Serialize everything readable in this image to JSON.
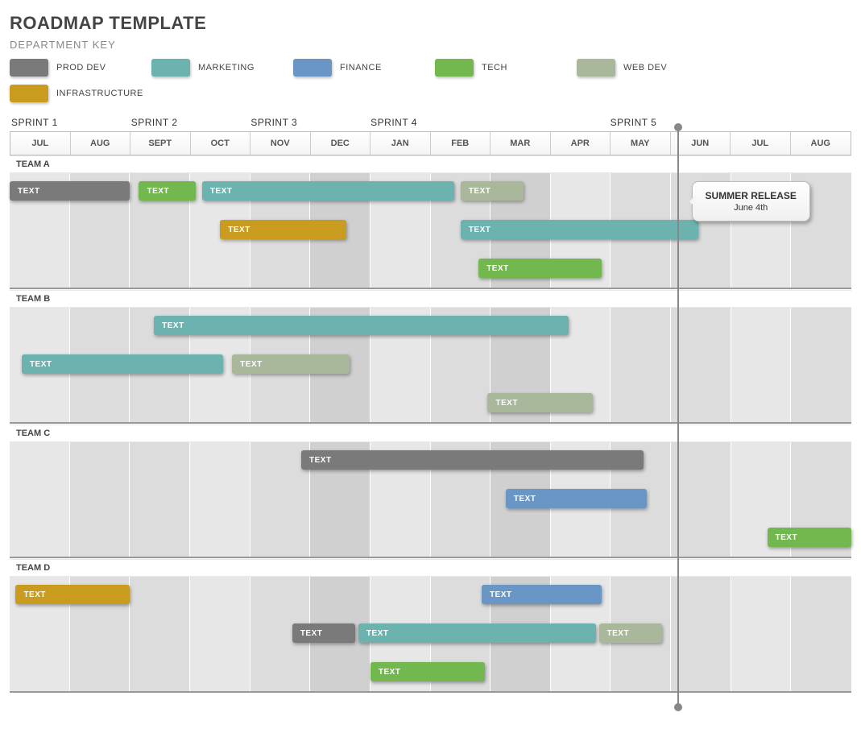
{
  "title": "ROADMAP TEMPLATE",
  "subtitle": "DEPARTMENT KEY",
  "departments": [
    {
      "name": "PROD DEV",
      "color": "#7a7a7a"
    },
    {
      "name": "MARKETING",
      "color": "#6cb3b0"
    },
    {
      "name": "FINANCE",
      "color": "#6a96c5"
    },
    {
      "name": "TECH",
      "color": "#73b74f"
    },
    {
      "name": "WEB DEV",
      "color": "#a9b79a"
    },
    {
      "name": "INFRASTRUCTURE",
      "color": "#c99c1f"
    }
  ],
  "sprints": [
    "SPRINT 1",
    "SPRINT 2",
    "SPRINT 3",
    "SPRINT 4",
    "SPRINT 5"
  ],
  "sprint_start_month_index": [
    0,
    2,
    3.6,
    6,
    10
  ],
  "months": [
    "JUL",
    "AUG",
    "SEPT",
    "OCT",
    "NOV",
    "DEC",
    "JAN",
    "FEB",
    "MAR",
    "APR",
    "MAY",
    "JUN",
    "JUL",
    "AUG"
  ],
  "month_shade": [
    "l",
    "m",
    "m",
    "l",
    "m",
    "d",
    "l",
    "m",
    "d",
    "l",
    "m",
    "m",
    "l",
    "m"
  ],
  "milestone": {
    "month_index": 11.1,
    "title": "SUMMER RELEASE",
    "subtitle": "June 4th"
  },
  "bar_label": "TEXT",
  "chart_data": {
    "type": "bar",
    "title": "ROADMAP TEMPLATE",
    "xlabel": "",
    "ylabel": "",
    "x_categories": [
      "JUL",
      "AUG",
      "SEPT",
      "OCT",
      "NOV",
      "DEC",
      "JAN",
      "FEB",
      "MAR",
      "APR",
      "MAY",
      "JUN",
      "JUL",
      "AUG"
    ],
    "teams": [
      {
        "name": "TEAM A",
        "lanes": 3,
        "bars": [
          {
            "lane": 0,
            "department": "PROD DEV",
            "start": 0.0,
            "end": 2.0,
            "label": "TEXT"
          },
          {
            "lane": 0,
            "department": "TECH",
            "start": 2.15,
            "end": 3.1,
            "label": "TEXT"
          },
          {
            "lane": 0,
            "department": "MARKETING",
            "start": 3.2,
            "end": 7.4,
            "label": "TEXT"
          },
          {
            "lane": 0,
            "department": "WEB DEV",
            "start": 7.5,
            "end": 8.55,
            "label": "TEXT"
          },
          {
            "lane": 1,
            "department": "INFRASTRUCTURE",
            "start": 3.5,
            "end": 5.6,
            "label": "TEXT"
          },
          {
            "lane": 1,
            "department": "MARKETING",
            "start": 7.5,
            "end": 11.45,
            "label": "TEXT"
          },
          {
            "lane": 2,
            "department": "TECH",
            "start": 7.8,
            "end": 9.85,
            "label": "TEXT"
          }
        ]
      },
      {
        "name": "TEAM B",
        "lanes": 3,
        "bars": [
          {
            "lane": 0,
            "department": "MARKETING",
            "start": 2.4,
            "end": 9.3,
            "label": "TEXT"
          },
          {
            "lane": 1,
            "department": "MARKETING",
            "start": 0.2,
            "end": 3.55,
            "label": "TEXT"
          },
          {
            "lane": 1,
            "department": "WEB DEV",
            "start": 3.7,
            "end": 5.65,
            "label": "TEXT"
          },
          {
            "lane": 2,
            "department": "WEB DEV",
            "start": 7.95,
            "end": 9.7,
            "label": "TEXT"
          }
        ]
      },
      {
        "name": "TEAM C",
        "lanes": 3,
        "bars": [
          {
            "lane": 0,
            "department": "PROD DEV",
            "start": 4.85,
            "end": 10.55,
            "label": "TEXT"
          },
          {
            "lane": 1,
            "department": "FINANCE",
            "start": 8.25,
            "end": 10.6,
            "label": "TEXT"
          },
          {
            "lane": 2,
            "department": "TECH",
            "start": 12.6,
            "end": 14.0,
            "label": "TEXT"
          }
        ]
      },
      {
        "name": "TEAM D",
        "lanes": 3,
        "bars": [
          {
            "lane": 0,
            "department": "INFRASTRUCTURE",
            "start": 0.1,
            "end": 2.0,
            "label": "TEXT"
          },
          {
            "lane": 0,
            "department": "FINANCE",
            "start": 7.85,
            "end": 9.85,
            "label": "TEXT"
          },
          {
            "lane": 1,
            "department": "PROD DEV",
            "start": 4.7,
            "end": 5.75,
            "label": "TEXT"
          },
          {
            "lane": 1,
            "department": "MARKETING",
            "start": 5.8,
            "end": 9.75,
            "label": "TEXT"
          },
          {
            "lane": 1,
            "department": "WEB DEV",
            "start": 9.8,
            "end": 10.85,
            "label": "TEXT"
          },
          {
            "lane": 2,
            "department": "TECH",
            "start": 6.0,
            "end": 7.9,
            "label": "TEXT"
          }
        ]
      }
    ]
  }
}
